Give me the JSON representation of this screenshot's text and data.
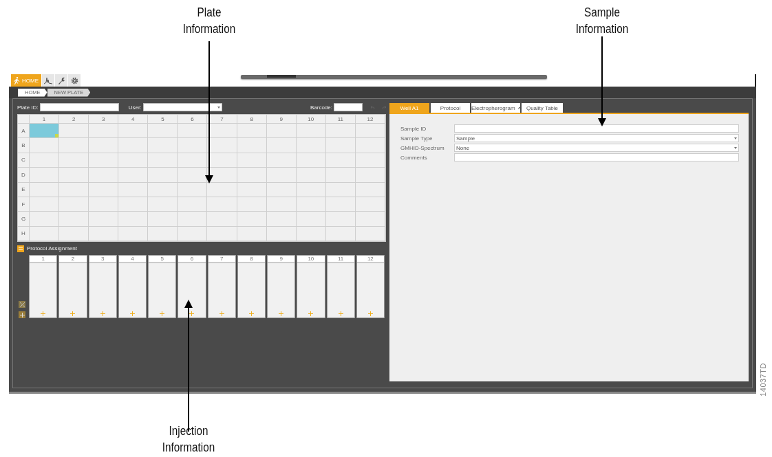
{
  "callouts": [
    {
      "label": "Plate Information"
    },
    {
      "label": "Sample Information"
    },
    {
      "label": "Injection Information"
    }
  ],
  "figure_id": "14037TD",
  "toolbar": {
    "home_tab": {
      "label": "HOME",
      "selected": true
    }
  },
  "breadcrumbs": [
    "HOME",
    "NEW PLATE"
  ],
  "plate": {
    "plate_id_label": "Plate ID:",
    "user_label": "User:",
    "barcode_label": "Barcode:",
    "columns": [
      "1",
      "2",
      "3",
      "4",
      "5",
      "6",
      "7",
      "8",
      "9",
      "10",
      "11",
      "12"
    ],
    "rows": [
      {
        "label": "A",
        "cells": [
          true,
          false,
          false,
          false,
          false,
          false,
          false,
          false,
          false,
          false,
          false,
          false
        ]
      },
      {
        "label": "B",
        "cells": [
          false,
          false,
          false,
          false,
          false,
          false,
          false,
          false,
          false,
          false,
          false,
          false
        ]
      },
      {
        "label": "C",
        "cells": [
          false,
          false,
          false,
          false,
          false,
          false,
          false,
          false,
          false,
          false,
          false,
          false
        ]
      },
      {
        "label": "D",
        "cells": [
          false,
          false,
          false,
          false,
          false,
          false,
          false,
          false,
          false,
          false,
          false,
          false
        ]
      },
      {
        "label": "E",
        "cells": [
          false,
          false,
          false,
          false,
          false,
          false,
          false,
          false,
          false,
          false,
          false,
          false
        ]
      },
      {
        "label": "F",
        "cells": [
          false,
          false,
          false,
          false,
          false,
          false,
          false,
          false,
          false,
          false,
          false,
          false
        ]
      },
      {
        "label": "G",
        "cells": [
          false,
          false,
          false,
          false,
          false,
          false,
          false,
          false,
          false,
          false,
          false,
          false
        ]
      },
      {
        "label": "H",
        "cells": [
          false,
          false,
          false,
          false,
          false,
          false,
          false,
          false,
          false,
          false,
          false,
          false
        ]
      }
    ]
  },
  "protocol_assignment": {
    "title": "Protocol Assignment",
    "injections": [
      "1",
      "2",
      "3",
      "4",
      "5",
      "6",
      "7",
      "8",
      "9",
      "10",
      "11",
      "12"
    ]
  },
  "sample_tabs": [
    {
      "label": "Well A1",
      "selected": true,
      "kind": "plain"
    },
    {
      "label": "Protocol",
      "selected": false,
      "kind": "plain"
    },
    {
      "label": "Electropherogram",
      "selected": false,
      "kind": "edit"
    },
    {
      "label": "Quality Table",
      "selected": false,
      "kind": "plain"
    }
  ],
  "sample_fields": [
    {
      "label": "Sample ID",
      "kind": "text"
    },
    {
      "label": "Sample Type",
      "kind": "select",
      "value": "Sample"
    },
    {
      "label": "GMHID-Spectrum",
      "kind": "select",
      "value": "None"
    },
    {
      "label": "Comments",
      "kind": "text"
    }
  ]
}
